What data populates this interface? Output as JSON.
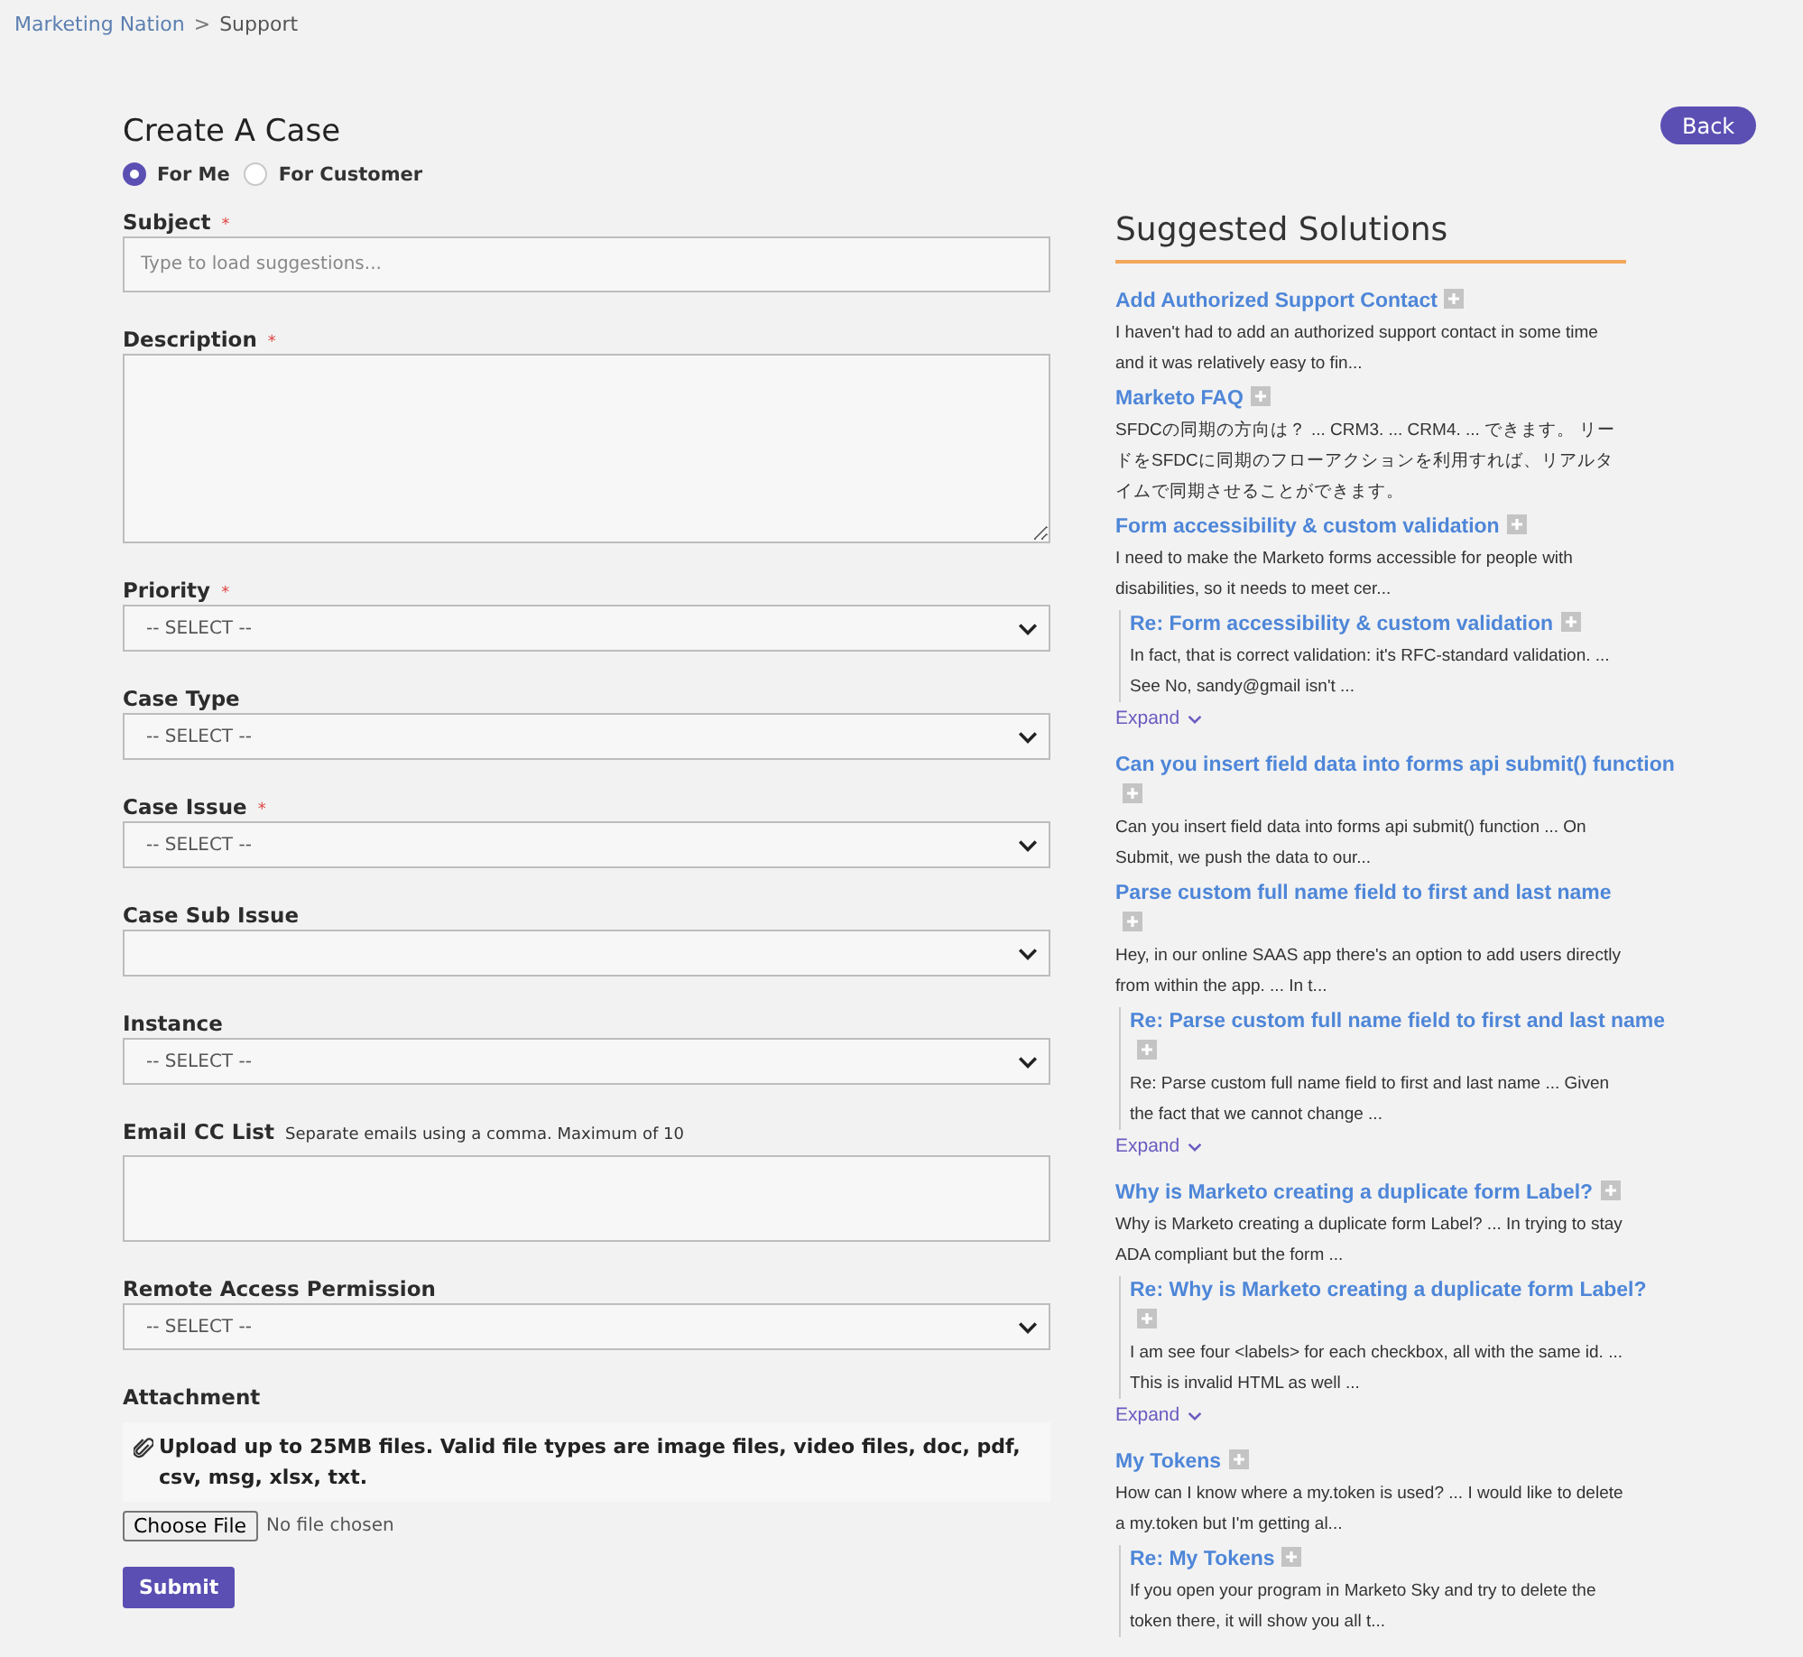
{
  "breadcrumb": {
    "items": [
      "Marketing Nation",
      "Support"
    ],
    "separator": ">"
  },
  "form": {
    "title": "Create A Case",
    "recipients": [
      {
        "label": "For Me",
        "selected": true
      },
      {
        "label": "For Customer",
        "selected": false
      }
    ],
    "fields": [
      {
        "kind": "text",
        "label": "Subject",
        "required_mark": "*",
        "placeholder": "Type to load suggestions..."
      },
      {
        "kind": "textarea",
        "label": "Description",
        "required_mark": "*"
      },
      {
        "kind": "select",
        "label": "Priority",
        "required_mark": "*",
        "value": "-- SELECT --"
      },
      {
        "kind": "select",
        "label": "Case Type",
        "value": "-- SELECT --"
      },
      {
        "kind": "select",
        "label": "Case Issue",
        "required_mark": "*",
        "value": "-- SELECT --"
      },
      {
        "kind": "select",
        "label": "Case Sub Issue"
      },
      {
        "kind": "select",
        "label": "Instance",
        "value": "-- SELECT --"
      },
      {
        "kind": "textarea_small",
        "label": "Email CC List",
        "hint": "Separate emails using a comma. Maximum of 10"
      },
      {
        "kind": "select",
        "label": "Remote Access Permission",
        "value": "-- SELECT --"
      }
    ],
    "attachment": {
      "label": "Attachment",
      "note": "Upload up to 25MB files. Valid file types are image files, video files, doc, pdf, csv, msg, xlsx, txt.",
      "file_button": "Choose File",
      "file_status": "No file chosen"
    },
    "submit": "Submit"
  },
  "back_button": "Back",
  "suggested": {
    "title": "Suggested Solutions",
    "items": [
      {
        "title": "Add Authorized Support Contact",
        "snippet": "I haven't had to add an authorized support contact in some time and it was relatively easy to fin..."
      },
      {
        "title": "Marketo FAQ",
        "snippet": "SFDCの同期の方向は？ ... CRM3. ... CRM4. ... できます。 リードをSFDCに同期のフローアクションを利用すれば、リアルタイムで同期させることができます。"
      },
      {
        "title": "Form accessibility & custom validation",
        "snippet": "I need to make the Marketo forms accessible for people with disabilities, so it needs to meet cer...",
        "replies": [
          {
            "title": "Re: Form accessibility & custom validation",
            "snippet": "In fact, that is correct validation: it's RFC-standard validation. ... See No, sandy@gmail isn't ..."
          }
        ],
        "expand": "Expand"
      },
      {
        "title": "Can you insert field data into forms api submit() function",
        "snippet": "Can you insert field data into forms api submit() function ... On Submit, we push the data to our..."
      },
      {
        "title": "Parse custom full name field to first and last name",
        "snippet": "Hey, in our online SAAS app there's an option to add users directly from within the app. ... In t...",
        "replies": [
          {
            "title": "Re: Parse custom full name field to first and last name",
            "snippet": "Re: Parse custom full name field to first and last name ... Given the fact that we cannot change ..."
          }
        ],
        "expand": "Expand"
      },
      {
        "title": "Why is Marketo creating a duplicate form Label?",
        "snippet": "Why is Marketo creating a duplicate form Label? ... In trying to stay ADA compliant but the form ...",
        "replies": [
          {
            "title": "Re: Why is Marketo creating a duplicate form Label?",
            "snippet": "I am see four <labels> for each checkbox, all with the same id. ... This is invalid HTML as well ..."
          }
        ],
        "expand": "Expand"
      },
      {
        "title": "My Tokens",
        "snippet": "How can I know where a my.token is used? ... I would like to delete a my.token but I'm getting al...",
        "replies": [
          {
            "title": "Re: My Tokens",
            "snippet": "If you open your program in Marketo Sky and try to delete the token there, it will show you all t..."
          }
        ]
      }
    ]
  }
}
